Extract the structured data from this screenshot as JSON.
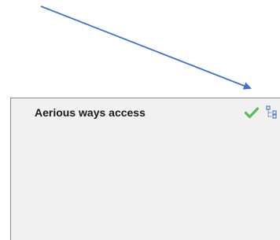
{
  "panel": {
    "title": "Aerious ways access",
    "status_icon": "green-check-icon",
    "action_icon": "hierarchy-tree-icon"
  },
  "annotation": {
    "arrow_color": "#4472c4"
  },
  "colors": {
    "panel_background": "#f1f1f1",
    "panel_border": "#8c8c8c",
    "check_green": "#5cb85c",
    "tree_icon_blue": "#5b7db8"
  }
}
